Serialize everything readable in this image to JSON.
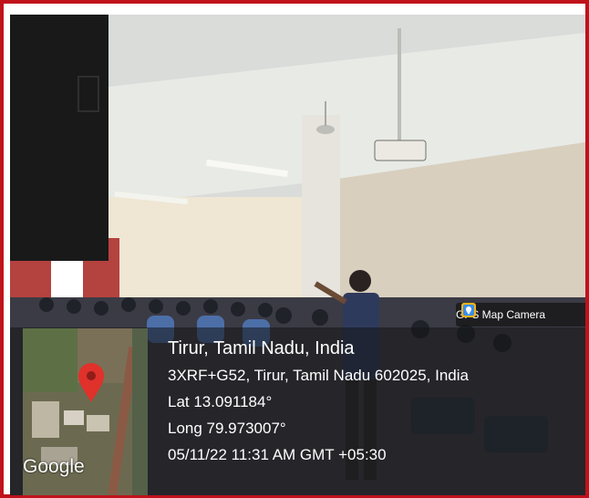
{
  "badge": {
    "label": "GPS Map Camera",
    "icon": "map-pin-app-icon"
  },
  "location": {
    "place": "Tirur, Tamil Nadu, India",
    "address": "3XRF+G52, Tirur, Tamil Nadu 602025, India",
    "lat": "Lat 13.091184°",
    "long": "Long 79.973007°",
    "datetime": "05/11/22 11:31 AM GMT +05:30"
  },
  "map": {
    "provider_label": "Google",
    "marker_color": "#e0312b"
  },
  "colors": {
    "frame": "#c0121b",
    "overlay": "#141414"
  }
}
